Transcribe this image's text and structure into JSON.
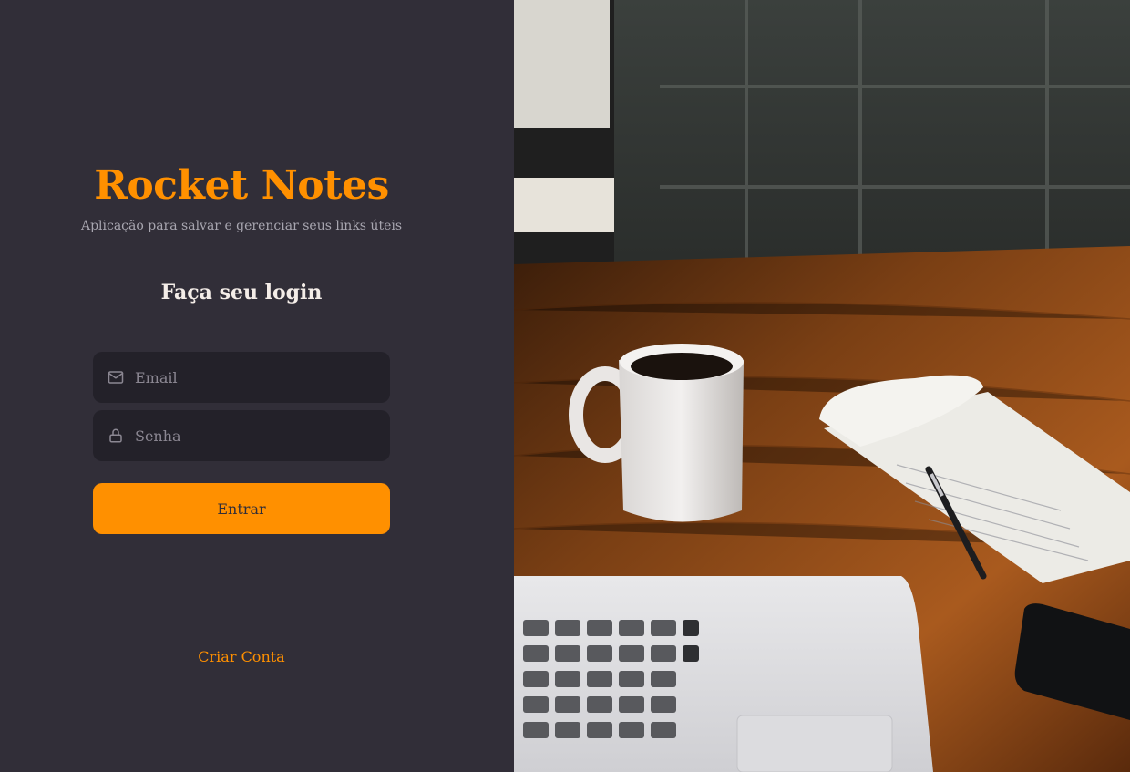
{
  "brand": {
    "title": "Rocket Notes",
    "subtitle": "Aplicação para salvar e gerenciar seus links úteis"
  },
  "login": {
    "heading": "Faça seu login",
    "email_placeholder": "Email",
    "email_icon": "mail-icon",
    "password_placeholder": "Senha",
    "password_icon": "lock-icon",
    "submit_label": "Entrar",
    "create_account_label": "Criar Conta"
  },
  "colors": {
    "background": "#312e38",
    "input_background": "#232129",
    "accent": "#ff9000",
    "text_light": "#f4ede8",
    "text_muted": "#a8a6b0"
  },
  "hero_image": {
    "description_icon": "workspace-photo"
  }
}
